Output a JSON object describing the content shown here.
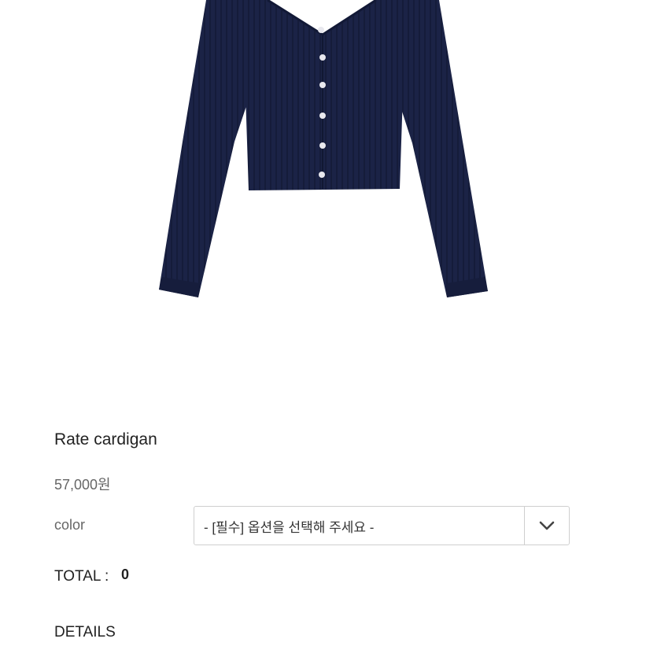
{
  "product": {
    "title": "Rate cardigan",
    "price": "57,000원",
    "image_icon": "navy-ribbed-cardigan"
  },
  "options": {
    "label": "color",
    "selected": "- [필수] 옵션을 선택해 주세요 -",
    "arrow_icon": "chevron-down-icon"
  },
  "total": {
    "label": "TOTAL :",
    "value": "0"
  },
  "details": {
    "heading": "DETAILS"
  },
  "colors": {
    "garment": "#1b2346",
    "buttons": "#e8e8ee",
    "text_muted": "#666666"
  }
}
